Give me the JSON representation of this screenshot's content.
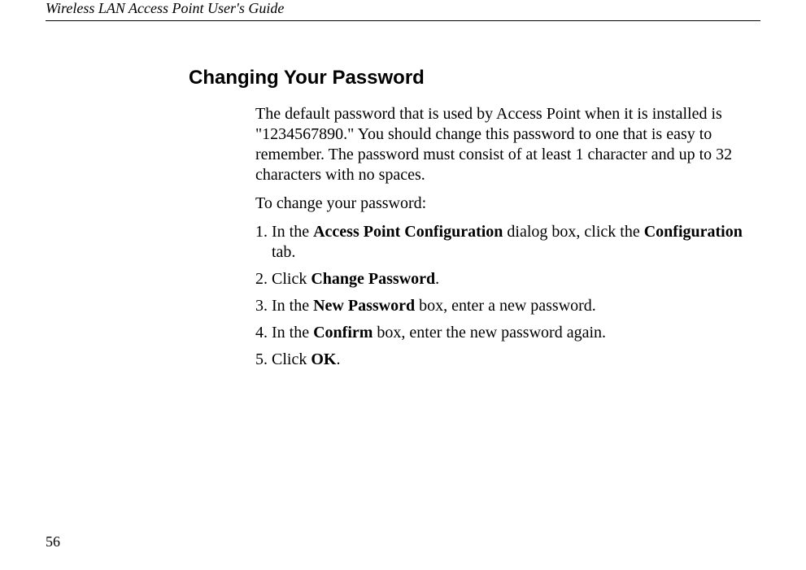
{
  "header": {
    "title": "Wireless LAN Access Point User's Guide"
  },
  "section": {
    "heading": "Changing Your Password",
    "intro": "The default password that is used by Access Point when it is installed is \"1234567890.\" You should change this password to one that is easy to remember. The password must consist of at least 1 character and up to 32 characters with no spaces.",
    "lead_in": "To change your password:",
    "steps": [
      {
        "num": "1.",
        "pre": "In the ",
        "b1": "Access Point Configuration",
        "mid": " dialog box, click the ",
        "b2": "Configuration",
        "post": " tab."
      },
      {
        "num": "2.",
        "pre": "Click ",
        "b1": "Change Password",
        "mid": "",
        "b2": "",
        "post": "."
      },
      {
        "num": "3.",
        "pre": "In the ",
        "b1": "New Password",
        "mid": " box, enter a new password.",
        "b2": "",
        "post": ""
      },
      {
        "num": "4.",
        "pre": "In the ",
        "b1": "Confirm",
        "mid": " box, enter the new password again.",
        "b2": "",
        "post": ""
      },
      {
        "num": "5.",
        "pre": "Click ",
        "b1": "OK",
        "mid": "",
        "b2": "",
        "post": "."
      }
    ]
  },
  "page_number": "56"
}
